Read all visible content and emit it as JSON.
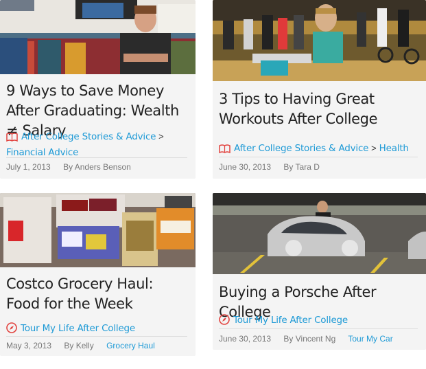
{
  "posts": [
    {
      "title": "9 Ways to Save Money After Graduating: Wealth ≠ Salary",
      "category_icon": "book-icon",
      "categories": [
        "After College Stories & Advice",
        "Financial Advice"
      ],
      "separator": ">",
      "date": "July 1, 2013",
      "author": "By Anders Benson",
      "tag": ""
    },
    {
      "title": "3 Tips to Having Great Workouts After College",
      "category_icon": "book-icon",
      "categories": [
        "After College Stories & Advice",
        "Health"
      ],
      "separator": ">",
      "date": "June 30, 2013",
      "author": "By Tara D",
      "tag": ""
    },
    {
      "title": "Costco Grocery Haul: Food for the Week",
      "category_icon": "compass-icon",
      "categories": [
        "Tour My Life After College"
      ],
      "separator": "",
      "date": "May 3, 2013",
      "author": "By Kelly",
      "tag": "Grocery Haul"
    },
    {
      "title": "Buying a Porsche After College",
      "category_icon": "compass-icon",
      "categories": [
        "Tour My Life After College"
      ],
      "separator": "",
      "date": "June 30, 2013",
      "author": "By Vincent Ng",
      "tag": "Tour My Car"
    }
  ],
  "colors": {
    "link": "#1e9ad6",
    "icon_red": "#e2433f",
    "card_bg": "#f4f4f4"
  },
  "images": [
    "man-on-couch-photo",
    "spin-class-photo",
    "groceries-photo",
    "silver-porsche-photo"
  ]
}
